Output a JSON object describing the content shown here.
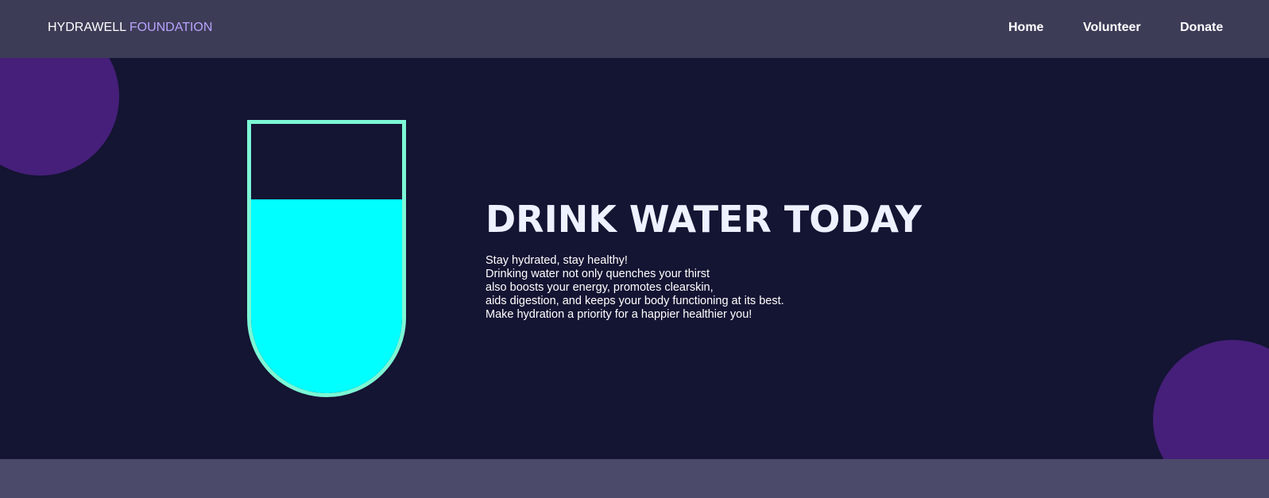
{
  "header": {
    "brand_primary": "HYDRAWELL",
    "brand_accent": "FOUNDATION",
    "accent_color": "#b9a3ff",
    "nav": {
      "home": "Home",
      "volunteer": "Volunteer",
      "donate": "Donate"
    }
  },
  "hero": {
    "title": "DRINK WATER TODAY",
    "lines": [
      "Stay hydrated, stay healthy!",
      "Drinking water not only quenches your thirst",
      "also boosts your energy, promotes clearskin,",
      "aids digestion, and keeps your body functioning at its best.",
      "Make hydration a priority for a happier healthier you!"
    ],
    "glass_fill_fraction": 0.72,
    "water_color": "#00ffff",
    "glass_outline_color": "#7cf7d6",
    "decor_circle_color": "#451f79",
    "background_color": "#141433"
  }
}
